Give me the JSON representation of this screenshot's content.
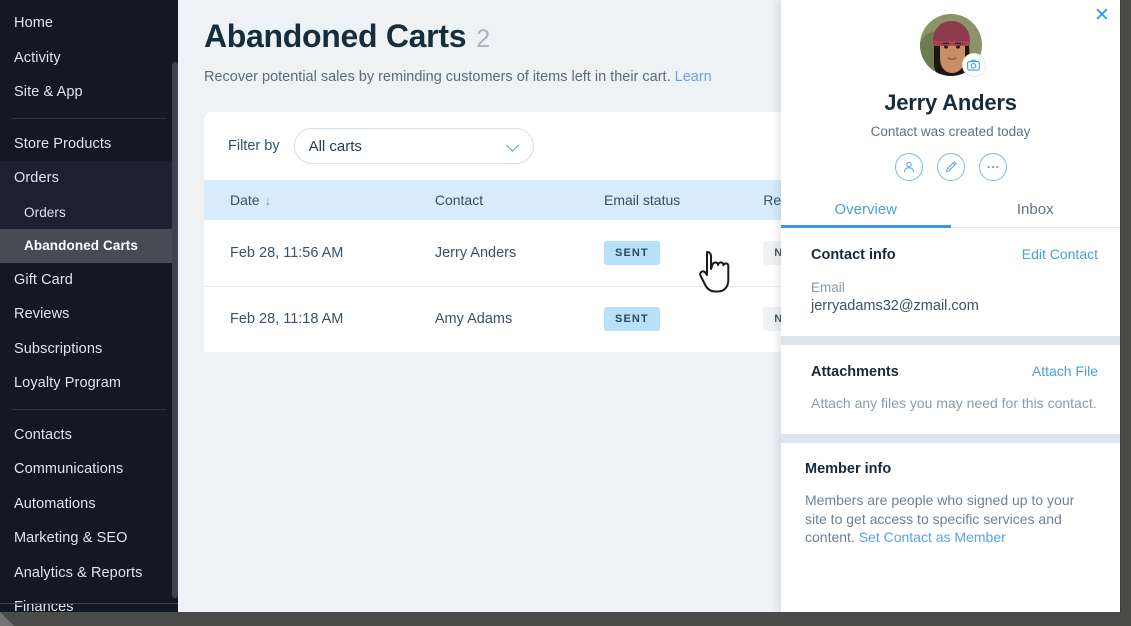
{
  "sidebar": {
    "items": [
      {
        "label": "Home",
        "type": "top"
      },
      {
        "label": "Activity",
        "type": "top"
      },
      {
        "label": "Site & App",
        "type": "top"
      },
      {
        "label": "Store Products",
        "type": "top"
      },
      {
        "label": "Orders",
        "type": "group-parent"
      },
      {
        "label": "Orders",
        "type": "sub"
      },
      {
        "label": "Abandoned Carts",
        "type": "sub-active"
      },
      {
        "label": "Gift Card",
        "type": "top"
      },
      {
        "label": "Reviews",
        "type": "top"
      },
      {
        "label": "Subscriptions",
        "type": "top"
      },
      {
        "label": "Loyalty Program",
        "type": "top"
      },
      {
        "label": "Contacts",
        "type": "top"
      },
      {
        "label": "Communications",
        "type": "top"
      },
      {
        "label": "Automations",
        "type": "top"
      },
      {
        "label": "Marketing & SEO",
        "type": "top"
      },
      {
        "label": "Analytics & Reports",
        "type": "top"
      },
      {
        "label": "Finances",
        "type": "top"
      }
    ]
  },
  "page": {
    "title": "Abandoned Carts",
    "count": "2",
    "subtitle": "Recover potential sales by reminding customers of items left in their cart. ",
    "subtitle_link": "Learn"
  },
  "filter": {
    "label": "Filter by",
    "selected": "All carts",
    "chevron_icon": "chevron-down-icon"
  },
  "table": {
    "columns": [
      "Date",
      "Contact",
      "Email status",
      "Recove"
    ],
    "sort_column": "Date",
    "sort_arrow": "↓",
    "rows": [
      {
        "date": "Feb 28, 11:56 AM",
        "contact": "Jerry Anders",
        "email_status": "SENT",
        "recovered": "NOT "
      },
      {
        "date": "Feb 28, 11:18 AM",
        "contact": "Amy Adams",
        "email_status": "SENT",
        "recovered": "NOT "
      }
    ]
  },
  "panel": {
    "close_icon": "close-icon",
    "avatar_icon": "avatar",
    "camera_icon": "camera-icon",
    "name": "Jerry Anders",
    "meta": "Contact was created today",
    "actions": [
      {
        "icon": "person-icon"
      },
      {
        "icon": "pencil-icon"
      },
      {
        "icon": "ellipsis-icon"
      }
    ],
    "tabs": [
      {
        "label": "Overview",
        "active": true
      },
      {
        "label": "Inbox",
        "active": false
      }
    ],
    "contact_info": {
      "title": "Contact info",
      "edit_link": "Edit Contact",
      "email_label": "Email",
      "email_value": "jerryadams32@zmail.com"
    },
    "attachments": {
      "title": "Attachments",
      "link": "Attach File",
      "body": "Attach any files you may need for this contact."
    },
    "member_info": {
      "title": "Member info",
      "body": "Members are people who signed up to your site to get access to specific services and content. ",
      "link": "Set Contact as Member"
    }
  },
  "colors": {
    "sidebar_bg": "#131825",
    "accent_blue": "#3899ec",
    "badge_sent_bg": "#b7e1fb",
    "badge_notrec_bg": "#f0f2f4",
    "table_header_bg": "#d8ecfb",
    "main_bg": "#eef2f5"
  }
}
